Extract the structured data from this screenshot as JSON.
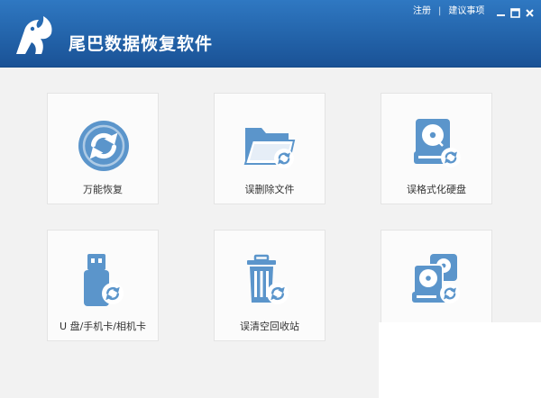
{
  "app": {
    "title": "尾巴数据恢复软件"
  },
  "toplinks": {
    "register": "注册",
    "separator": "|",
    "suggestions": "建议事项"
  },
  "cards": [
    {
      "label": "万能恢复",
      "icon": "refresh-circle-icon"
    },
    {
      "label": "误删除文件",
      "icon": "folder-refresh-icon"
    },
    {
      "label": "误格式化硬盘",
      "icon": "harddisk-refresh-icon"
    },
    {
      "label": "U 盘/手机卡/相机卡",
      "icon": "usb-drive-refresh-icon"
    },
    {
      "label": "误清空回收站",
      "icon": "recycle-bin-refresh-icon"
    },
    {
      "label": "",
      "icon": "multi-disk-refresh-icon"
    }
  ],
  "colors": {
    "header": "#2567ae",
    "icon": "#5b95cb",
    "background": "#f2f2f2"
  }
}
